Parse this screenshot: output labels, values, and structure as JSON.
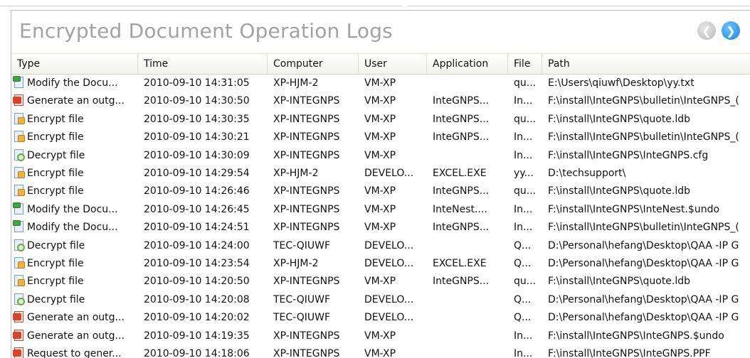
{
  "window": {
    "title": "Encrypted Document Operation Logs",
    "back_button": "back-arrow-icon",
    "forward_button": "forward-arrow-icon"
  },
  "columns": [
    "Type",
    "Time",
    "Computer",
    "User",
    "Application",
    "File",
    "Path"
  ],
  "rows": [
    {
      "icon": "modify-icon",
      "type": "Modify the Docu...",
      "time": "2010-09-10 14:31:05",
      "computer": "XP-HJM-2",
      "user": "VM-XP",
      "application": "",
      "file": "qu...",
      "path": "E:\\Users\\qiuwf\\Desktop\\yy.txt"
    },
    {
      "icon": "generate-icon",
      "type": "Generate an outg...",
      "time": "2010-09-10 14:30:50",
      "computer": "XP-INTEGNPS",
      "user": "VM-XP",
      "application": "InteGNPS...",
      "file": "In...",
      "path": "F:\\install\\InteGNPS\\bulletin\\InteGNPS_("
    },
    {
      "icon": "encrypt-icon",
      "type": "Encrypt file",
      "time": "2010-09-10 14:30:35",
      "computer": "XP-INTEGNPS",
      "user": "VM-XP",
      "application": "InteGNPS...",
      "file": "qu...",
      "path": "F:\\install\\InteGNPS\\quote.ldb"
    },
    {
      "icon": "encrypt-icon",
      "type": "Encrypt file",
      "time": "2010-09-10 14:30:21",
      "computer": "XP-INTEGNPS",
      "user": "VM-XP",
      "application": "InteGNPS...",
      "file": "In...",
      "path": "F:\\install\\InteGNPS\\bulletin\\InteGNPS_("
    },
    {
      "icon": "decrypt-icon",
      "type": "Decrypt file",
      "time": "2010-09-10 14:30:09",
      "computer": "XP-INTEGNPS",
      "user": "VM-XP",
      "application": "",
      "file": "In...",
      "path": "F:\\install\\InteGNPS\\InteGNPS.cfg"
    },
    {
      "icon": "encrypt-icon",
      "type": "Encrypt file",
      "time": "2010-09-10 14:29:54",
      "computer": "XP-HJM-2",
      "user": "DEVELO...",
      "application": "EXCEL.EXE",
      "file": "yy...",
      "path": "D:\\techsupport\\"
    },
    {
      "icon": "encrypt-icon",
      "type": "Encrypt file",
      "time": "2010-09-10 14:26:46",
      "computer": "XP-INTEGNPS",
      "user": "VM-XP",
      "application": "InteGNPS...",
      "file": "qu...",
      "path": "F:\\install\\InteGNPS\\quote.ldb"
    },
    {
      "icon": "modify-icon",
      "type": "Modify the Docu...",
      "time": "2010-09-10 14:26:45",
      "computer": "XP-INTEGNPS",
      "user": "VM-XP",
      "application": "InteNest....",
      "file": "In...",
      "path": "F:\\install\\InteGNPS\\InteNest.$undo"
    },
    {
      "icon": "modify-icon",
      "type": "Modify the Docu...",
      "time": "2010-09-10 14:24:51",
      "computer": "XP-INTEGNPS",
      "user": "VM-XP",
      "application": "InteGNPS...",
      "file": "In...",
      "path": "F:\\install\\InteGNPS\\bulletin\\InteGNPS_("
    },
    {
      "icon": "decrypt-icon",
      "type": "Decrypt file",
      "time": "2010-09-10 14:24:00",
      "computer": "TEC-QIUWF",
      "user": "DEVELO...",
      "application": "",
      "file": "Q...",
      "path": "D:\\Personal\\hefang\\Desktop\\QAA -IP G"
    },
    {
      "icon": "encrypt-icon",
      "type": "Encrypt file",
      "time": "2010-09-10 14:23:54",
      "computer": "XP-HJM-2",
      "user": "DEVELO...",
      "application": "EXCEL.EXE",
      "file": "Q...",
      "path": "D:\\Personal\\hefang\\Desktop\\QAA -IP G"
    },
    {
      "icon": "encrypt-icon",
      "type": "Encrypt file",
      "time": "2010-09-10 14:20:50",
      "computer": "XP-INTEGNPS",
      "user": "VM-XP",
      "application": "InteGNPS...",
      "file": "qu...",
      "path": "F:\\install\\InteGNPS\\quote.ldb"
    },
    {
      "icon": "decrypt-icon",
      "type": "Decrypt file",
      "time": "2010-09-10 14:20:08",
      "computer": "TEC-QIUWF",
      "user": "DEVELO...",
      "application": "",
      "file": "Q...",
      "path": "D:\\Personal\\hefang\\Desktop\\QAA -IP G"
    },
    {
      "icon": "generate-icon",
      "type": "Generate an outg...",
      "time": "2010-09-10 14:20:02",
      "computer": "TEC-QIUWF",
      "user": "DEVELO...",
      "application": "",
      "file": "Q...",
      "path": "D:\\Personal\\hefang\\Desktop\\QAA -IP G"
    },
    {
      "icon": "generate-icon",
      "type": "Generate an outg...",
      "time": "2010-09-10 14:19:35",
      "computer": "XP-INTEGNPS",
      "user": "VM-XP",
      "application": "",
      "file": "In...",
      "path": "F:\\install\\InteGNPS\\InteGNPS.$undo"
    },
    {
      "icon": "request-icon",
      "type": "Request to gener...",
      "time": "2010-09-10 14:18:06",
      "computer": "XP-INTEGNPS",
      "user": "VM-XP",
      "application": "",
      "file": "In...",
      "path": "F:\\install\\InteGNPS\\InteGNPS.PPF"
    }
  ]
}
